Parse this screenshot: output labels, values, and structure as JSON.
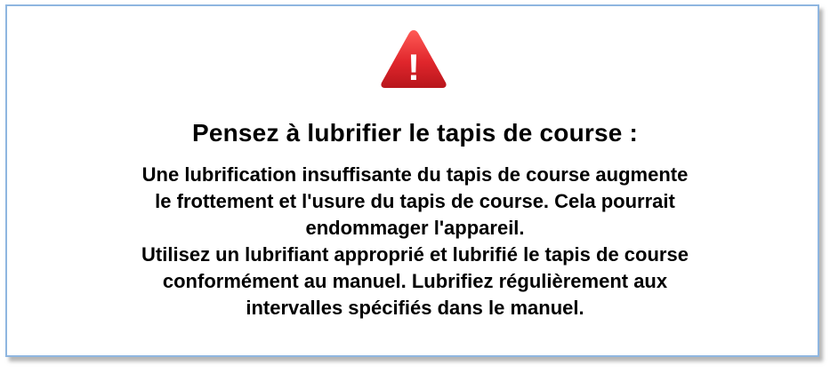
{
  "colors": {
    "border": "#8fb6e0",
    "warning_red": "#e0262c",
    "warning_symbol": "#ffffff",
    "text": "#000000"
  },
  "icon": {
    "name": "warning-triangle-icon",
    "symbol": "!"
  },
  "title": "Pensez à lubrifier le tapis de course :",
  "body": {
    "lines": [
      "Une lubrification insuffisante du tapis de course augmente",
      "le frottement et l'usure du tapis de course. Cela pourrait",
      "endommager l'appareil.",
      "Utilisez un lubrifiant approprié et lubrifié le tapis de course",
      "conformément au manuel. Lubrifiez régulièrement aux",
      "intervalles spécifiés dans le manuel."
    ]
  }
}
